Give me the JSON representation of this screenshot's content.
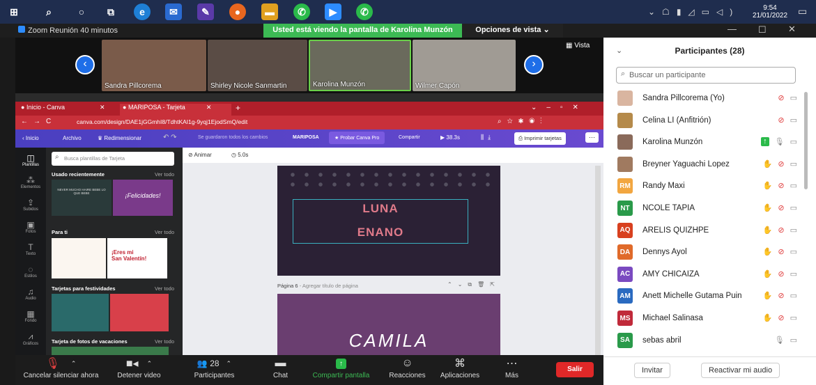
{
  "taskbar": {
    "time": "9:54",
    "date": "21/01/2022"
  },
  "zoom": {
    "title": "Zoom Reunión 40 minutos",
    "sharing_banner": "Usted está viendo la pantalla de Karolina Munzón",
    "view_options": "Opciones de vista ⌄",
    "view_label": "Vista"
  },
  "videos": [
    {
      "name": "Sandra Pillcorema",
      "bg": "#7a5b4a"
    },
    {
      "name": "Shirley Nicole Sanmartin",
      "bg": "#5a4c45"
    },
    {
      "name": "Karolina Munzón",
      "bg": "#6a6a5c"
    },
    {
      "name": "Wilmer Capón",
      "bg": "#a09b94"
    }
  ],
  "browser": {
    "tabs": [
      "Inicio - Canva",
      "MARIPOSA - Tarjeta"
    ],
    "url": "canva.com/design/DAE1jGGmhI8/TdhtKAI1g-9yqj1EjodSmQ/edit",
    "menu": {
      "home": "Inicio",
      "file": "Archivo",
      "resize": "Redimensionar",
      "saved": "Se guardaron todos los cambios",
      "doc": "MARIPOSA",
      "try_pro": "Probar Canva Pro",
      "share": "Compartir",
      "time": "38.3s",
      "print": "Imprimir tarjetas"
    },
    "rail": [
      "Plantillas",
      "Elementos",
      "Subidos",
      "Fotos",
      "Texto",
      "Estilos",
      "Audio",
      "Fondo",
      "Gráficos"
    ],
    "search_placeholder": "Busca plantillas de Tarjeta",
    "sections": [
      {
        "title": "Usado recientemente",
        "more": "Ver todo"
      },
      {
        "title": "Para ti",
        "more": "Ver todo"
      },
      {
        "title": "Tarjetas para festividades",
        "more": "Ver todo"
      },
      {
        "title": "Tarjeta de fotos de vacaciones",
        "more": "Ver todo"
      }
    ],
    "thumb_texts": {
      "felicidades": "¡Felicidades!",
      "valentin_1": "¡Eres mi",
      "valentin_2": "San Valentín!",
      "nieve": "NEVER MUCHO HAIRE BEBE LO QUE BEBE"
    },
    "editor": {
      "animate": "Animar",
      "duration": "5.0s",
      "luna": "LUNA",
      "enano": "ENANO",
      "page_label": "Página 6",
      "page_title_hint": " - Agregar título de página",
      "camila": "CAMILA"
    }
  },
  "bottom": {
    "mute": "Cancelar silenciar ahora",
    "video": "Detener video",
    "participants": "Participantes",
    "participants_count": "28",
    "chat": "Chat",
    "share": "Compartir pantalla",
    "reactions": "Reacciones",
    "apps": "Aplicaciones",
    "more": "Más",
    "leave": "Salir"
  },
  "participants": {
    "title": "Participantes (28)",
    "search_placeholder": "Buscar un participante",
    "list": [
      {
        "name": "Sandra Pillcorema (Yo)",
        "initials": "",
        "color": "#d9b5a0"
      },
      {
        "name": "Celina LI (Anfitrión)",
        "initials": "",
        "color": "#b58a4a"
      },
      {
        "name": "Karolina Munzón",
        "initials": "",
        "color": "#8a6a5a"
      },
      {
        "name": "Breyner Yaguachi Lopez",
        "initials": "",
        "color": "#a07a60"
      },
      {
        "name": "Randy Maxi",
        "initials": "RM",
        "color": "#f2a640"
      },
      {
        "name": "NCOLE TAPIA",
        "initials": "NT",
        "color": "#2a9a4a"
      },
      {
        "name": "ARELIS QUIZHPE",
        "initials": "AQ",
        "color": "#d8401f"
      },
      {
        "name": "Dennys Ayol",
        "initials": "DA",
        "color": "#e06a2a"
      },
      {
        "name": "AMY CHICAIZA",
        "initials": "AC",
        "color": "#7a4ac0"
      },
      {
        "name": "Anett Michelle Gutama Puin",
        "initials": "AM",
        "color": "#2a6ac0"
      },
      {
        "name": "Michael Salinasa",
        "initials": "MS",
        "color": "#c02a3a"
      },
      {
        "name": "sebas abril",
        "initials": "SA",
        "color": "#2a9a4a"
      }
    ],
    "invite": "Invitar",
    "reactivate": "Reactivar mi audio"
  }
}
